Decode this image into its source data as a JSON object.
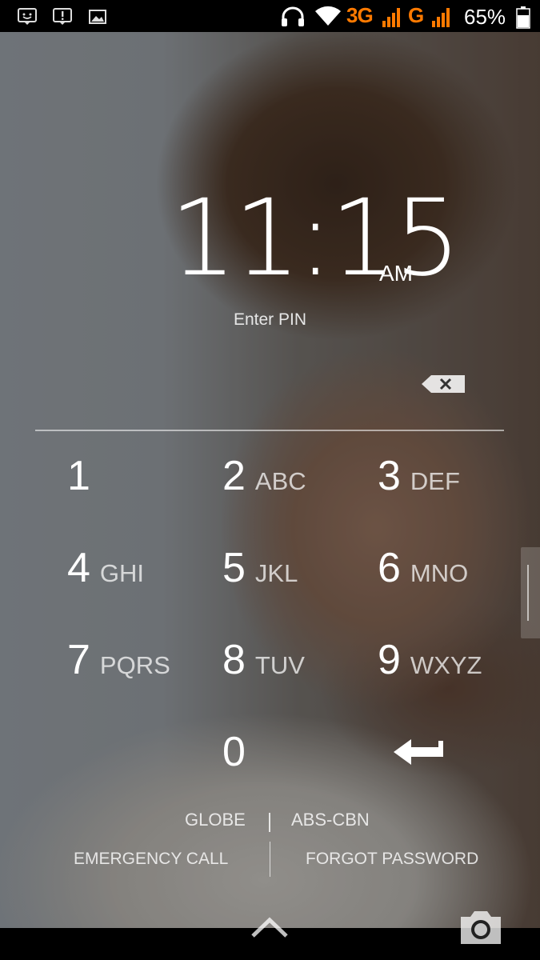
{
  "status_bar": {
    "notification_icons": [
      "messenger-icon",
      "alert-icon",
      "gallery-icon"
    ],
    "headset_icon": "headset-icon",
    "wifi_icon": "wifi-icon",
    "network_primary": "3G",
    "network_secondary": "G",
    "battery_percent": "65%",
    "network_color": "#ff7a00"
  },
  "lockscreen": {
    "time": "11:15",
    "ampm": "AM",
    "prompt": "Enter PIN",
    "keypad": [
      {
        "digit": "1",
        "letters": ""
      },
      {
        "digit": "2",
        "letters": "ABC"
      },
      {
        "digit": "3",
        "letters": "DEF"
      },
      {
        "digit": "4",
        "letters": "GHI"
      },
      {
        "digit": "5",
        "letters": "JKL"
      },
      {
        "digit": "6",
        "letters": "MNO"
      },
      {
        "digit": "7",
        "letters": "PQRS"
      },
      {
        "digit": "8",
        "letters": "TUV"
      },
      {
        "digit": "9",
        "letters": "WXYZ"
      },
      {
        "digit": "0",
        "letters": ""
      }
    ],
    "carriers": [
      "GLOBE",
      "ABS-CBN"
    ],
    "emergency_label": "EMERGENCY CALL",
    "forgot_label": "FORGOT PASSWORD"
  },
  "nav": {
    "unlock_icon": "chevron-up-icon",
    "camera_icon": "camera-icon"
  }
}
